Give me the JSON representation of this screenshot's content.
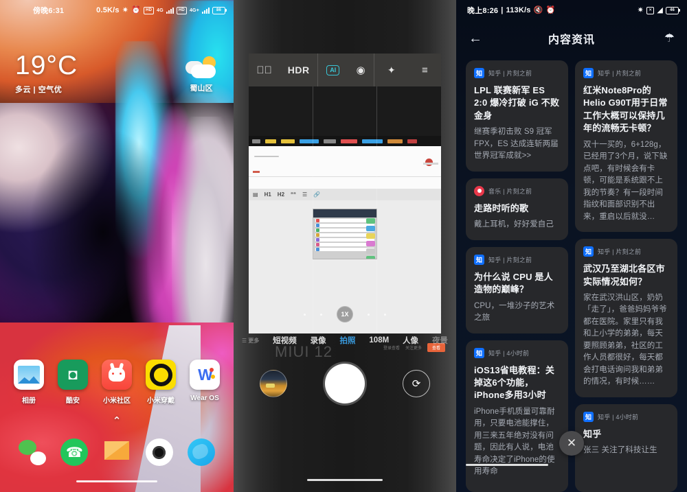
{
  "home": {
    "status": {
      "time": "傍晚6:31",
      "speed": "0.5K/s",
      "net1": "4G",
      "net2": "4G+",
      "battery": "86"
    },
    "weather": {
      "temp": "19°C",
      "desc": "多云 | 空气优",
      "city": "蜀山区",
      "icon": "partly-cloudy-icon"
    },
    "apps": [
      {
        "label": "相册",
        "icon": "gallery-icon"
      },
      {
        "label": "酷安",
        "icon": "coolapk-icon"
      },
      {
        "label": "小米社区",
        "icon": "mi-community-icon"
      },
      {
        "label": "小米穿戴",
        "icon": "mi-wear-icon"
      },
      {
        "label": "Wear OS",
        "icon": "wear-os-icon"
      }
    ],
    "drawer_arrow": "⌃",
    "dock": [
      {
        "name": "wechat-icon"
      },
      {
        "name": "phone-icon"
      },
      {
        "name": "messages-icon"
      },
      {
        "name": "camera-icon"
      },
      {
        "name": "browser-icon"
      }
    ]
  },
  "camera": {
    "top_controls": [
      {
        "label": "⚡",
        "name": "flash-off-icon"
      },
      {
        "label": "HDR",
        "name": "hdr-button"
      },
      {
        "label": "AI",
        "name": "ai-scene-button",
        "active": true
      },
      {
        "label": "◉",
        "name": "motion-photo-icon"
      },
      {
        "label": "✦",
        "name": "beauty-filter-icon"
      },
      {
        "label": "≡",
        "name": "camera-menu-icon"
      }
    ],
    "zoom": {
      "level": "1X"
    },
    "modes": [
      {
        "label": "短视频"
      },
      {
        "label": "录像"
      },
      {
        "label": "拍照",
        "active": true
      },
      {
        "label": "108M"
      },
      {
        "label": "人像"
      },
      {
        "label": "夜景"
      }
    ],
    "watermark": "MIUI 12",
    "shutter": "shutter-button",
    "flip": "⟳",
    "accent_active": "#3ca7f0",
    "accent_ai": "#39c6d6"
  },
  "feed": {
    "status": {
      "time": "晚上8:26",
      "speed": "113K/s",
      "battery": "46"
    },
    "header": {
      "back": "←",
      "title": "内容资讯",
      "bell": "notification-settings-icon"
    },
    "close_label": "✕",
    "left_column": [
      {
        "source": "知乎",
        "badge": "知",
        "badge_type": "zhihu",
        "time": "片刻之前",
        "title": "LPL 联赛新军 ES 2:0 爆冷打破 iG 不败金身",
        "body": "继赛季初击败 S9 冠军 FPX，ES 达成连斩两届世界冠军成就>>"
      },
      {
        "source": "音乐",
        "badge": "",
        "badge_type": "music",
        "time": "片刻之前",
        "title": "走路时听的歌",
        "body": "戴上耳机，好好爱自己"
      },
      {
        "source": "知乎",
        "badge": "知",
        "badge_type": "zhihu",
        "time": "片刻之前",
        "title": "为什么说 CPU 是人造物的巅峰？",
        "body": "CPU，一堆沙子的艺术之旅"
      },
      {
        "source": "知乎",
        "badge": "知",
        "badge_type": "zhihu",
        "time": "4小时前",
        "title": "iOS13省电教程：关掉这6个功能，iPhone多用3小时",
        "body": "iPhone手机质量可靠耐用，只要电池能撑住，用三来五年绝对没有问题，因此有人说，电池寿命决定了iPhone的使用寿命"
      }
    ],
    "right_column": [
      {
        "source": "知乎",
        "badge": "知",
        "badge_type": "zhihu",
        "time": "片刻之前",
        "title": "红米Note8Pro的Helio G90T用于日常工作大概可以保持几年的流畅无卡顿？",
        "body": "双十一买的，6+128g，已经用了3个月，说下缺点吧，有时候会有卡顿，可能是系统跟不上我的节奏？有一段时间指纹和面部识别不出来，重启以后就没…"
      },
      {
        "source": "知乎",
        "badge": "知",
        "badge_type": "zhihu",
        "time": "片刻之前",
        "title": "武汉乃至湖北各区市实际情况如何？",
        "body": "家在武汉洪山区，奶奶「走了」，爸爸妈妈爷爷都在医院。家里只有我和上小学的弟弟，每天要照顾弟弟，社区的工作人员都很好，每天都会打电话询问我和弟弟的情况，有时候……"
      },
      {
        "source": "知乎",
        "badge": "知",
        "badge_type": "zhihu",
        "time": "4小时前",
        "title": "知乎",
        "body": "张三 关注了科技让生"
      }
    ]
  }
}
